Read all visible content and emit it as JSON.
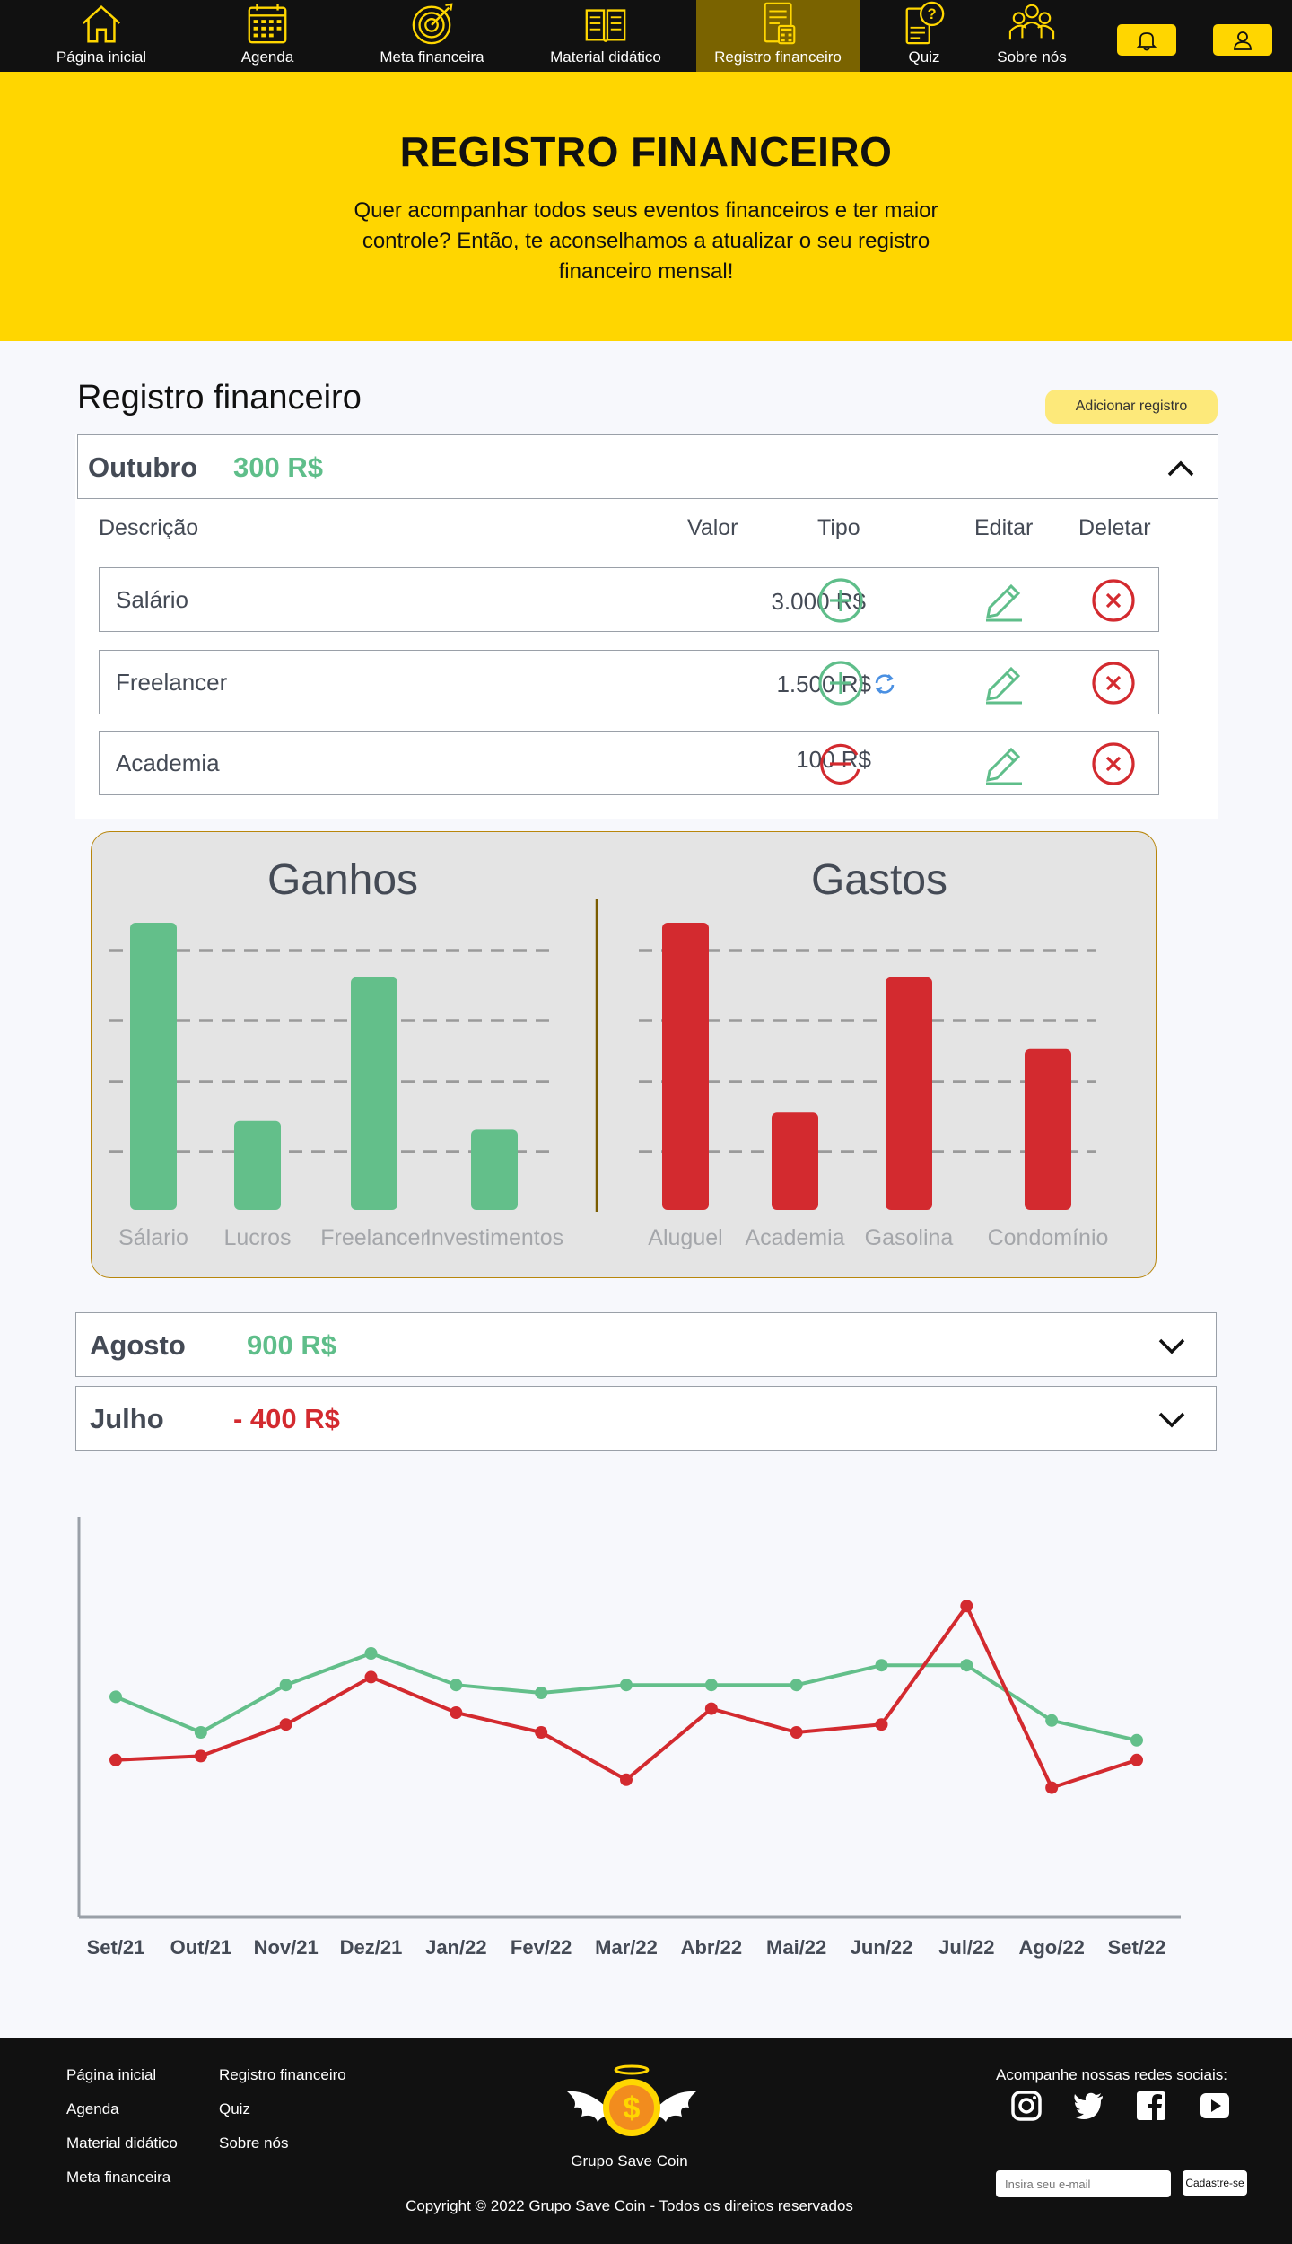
{
  "nav": {
    "items": [
      {
        "label": "Página inicial",
        "icon": "home-icon"
      },
      {
        "label": "Agenda",
        "icon": "calendar-icon"
      },
      {
        "label": "Meta financeira",
        "icon": "target-icon"
      },
      {
        "label": "Material didático",
        "icon": "book-icon"
      },
      {
        "label": "Registro financeiro",
        "icon": "document-icon"
      },
      {
        "label": "Quiz",
        "icon": "quiz-icon"
      },
      {
        "label": "Sobre nós",
        "icon": "group-icon"
      }
    ],
    "active": "Registro financeiro",
    "accent": "#ffd600",
    "active_bg": "#7a6300"
  },
  "hero": {
    "title": "REGISTRO FINANCEIRO",
    "subtitle": "Quer acompanhar todos seus eventos financeiros e ter maior controle? Então, te aconselhamos a atualizar o seu registro financeiro mensal!"
  },
  "records": {
    "section_title": "Registro financeiro",
    "add_label": "Adicionar registro",
    "headers": {
      "desc": "Descrição",
      "value": "Valor",
      "type": "Tipo",
      "edit": "Editar",
      "delete": "Deletar"
    },
    "months": [
      {
        "name": "Outubro",
        "total": "300 R$",
        "expanded": true,
        "color": "#5fbe8a"
      },
      {
        "name": "Agosto",
        "total": "900 R$",
        "expanded": false,
        "color": "#5fbe8a"
      },
      {
        "name": "Julho",
        "total": "- 400 R$",
        "expanded": false,
        "color": "#d32a2f"
      }
    ],
    "rows": [
      {
        "desc": "Salário",
        "value": "3.000 R$",
        "type": "income",
        "recurring": false
      },
      {
        "desc": "Freelancer",
        "value": "1.500 R$",
        "type": "income",
        "recurring": true
      },
      {
        "desc": "Academia",
        "value": "100 R$",
        "type": "expense",
        "recurring": false
      }
    ]
  },
  "chart_data": [
    {
      "type": "bar",
      "title": "Ganhos",
      "categories": [
        "Sálario",
        "Lucros",
        "Freelancer",
        "Investimentos"
      ],
      "values": [
        100,
        31,
        81,
        28
      ],
      "color": "#63bf8a"
    },
    {
      "type": "bar",
      "title": "Gastos",
      "categories": [
        "Aluguel",
        "Academia",
        "Gasolina",
        "Condomínio"
      ],
      "values": [
        100,
        34,
        81,
        56
      ],
      "color": "#d32a2f"
    },
    {
      "type": "line",
      "categories": [
        "Set/21",
        "Out/21",
        "Nov/21",
        "Dez/21",
        "Jan/22",
        "Fev/22",
        "Mar/22",
        "Abr/22",
        "Mai/22",
        "Jun/22",
        "Jul/22",
        "Ago/22",
        "Set/22"
      ],
      "series": [
        {
          "values": [
            59,
            50,
            62,
            70,
            62,
            60,
            62,
            62,
            62,
            67,
            67,
            53,
            48
          ],
          "color": "#63bf8a"
        },
        {
          "values": [
            43,
            44,
            52,
            64,
            55,
            50,
            38,
            56,
            50,
            52,
            82,
            36,
            43
          ],
          "color": "#d32a2f"
        }
      ],
      "ylim": [
        0,
        100
      ]
    }
  ],
  "footer": {
    "links_col1": [
      "Página inicial",
      "Agenda",
      "Material didático",
      "Meta financeira"
    ],
    "links_col2": [
      "Registro financeiro",
      "Quiz",
      "Sobre nós"
    ],
    "brand": "Grupo Save Coin",
    "social_title": "Acompanhe nossas redes sociais:",
    "social": [
      "instagram-icon",
      "twitter-icon",
      "facebook-icon",
      "youtube-icon"
    ],
    "email_placeholder": "Insira seu e-mail",
    "subscribe_label": "Cadastre-se",
    "copyright": "Copyright © 2022 Grupo Save Coin - Todos os direitos reservados"
  }
}
